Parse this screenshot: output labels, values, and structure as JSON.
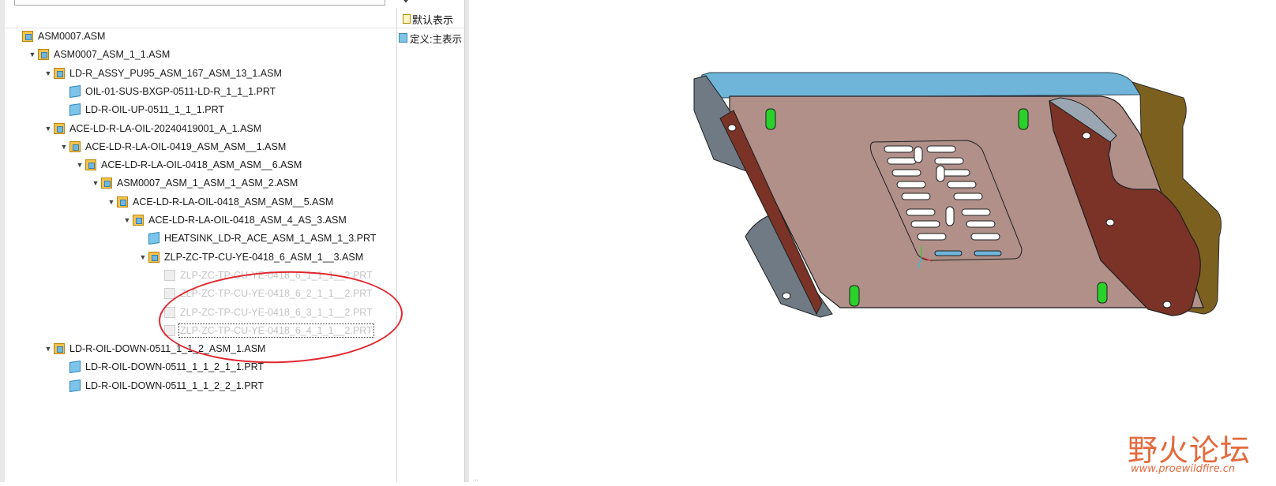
{
  "search": {
    "placeholder": ""
  },
  "columns": {
    "display_header": "默认表示",
    "definition_cell": "定义:主表示"
  },
  "tree": [
    {
      "label": "ASM0007.ASM",
      "toggle": "",
      "type": "asm"
    },
    {
      "label": "ASM0007_ASM_1_1.ASM",
      "toggle": "▼",
      "type": "asm"
    },
    {
      "label": "LD-R_ASSY_PU95_ASM_167_ASM_13_1.ASM",
      "toggle": "▼",
      "type": "asm"
    },
    {
      "label": "OIL-01-SUS-BXGP-0511-LD-R_1_1_1.PRT",
      "toggle": "",
      "type": "prt"
    },
    {
      "label": "LD-R-OIL-UP-0511_1_1_1.PRT",
      "toggle": "",
      "type": "prt"
    },
    {
      "label": "ACE-LD-R-LA-OIL-20240419001_A_1.ASM",
      "toggle": "▼",
      "type": "asm"
    },
    {
      "label": "ACE-LD-R-LA-OIL-0419_ASM_ASM__1.ASM",
      "toggle": "▼",
      "type": "asm"
    },
    {
      "label": "ACE-LD-R-LA-OIL-0418_ASM_ASM__6.ASM",
      "toggle": "▼",
      "type": "asm"
    },
    {
      "label": "ASM0007_ASM_1_ASM_1_ASM_2.ASM",
      "toggle": "▼",
      "type": "asm"
    },
    {
      "label": "ACE-LD-R-LA-OIL-0418_ASM_ASM__5.ASM",
      "toggle": "▼",
      "type": "asm"
    },
    {
      "label": "ACE-LD-R-LA-OIL-0418_ASM_4_AS_3.ASM",
      "toggle": "▼",
      "type": "asm"
    },
    {
      "label": "HEATSINK_LD-R_ACE_ASM_1_ASM_1_3.PRT",
      "toggle": "",
      "type": "prt"
    },
    {
      "label": "ZLP-ZC-TP-CU-YE-0418_6_ASM_1__3.ASM",
      "toggle": "▼",
      "type": "asm"
    },
    {
      "label": "ZLP-ZC-TP-CU-YE-0418_6_1_1_1__2.PRT",
      "toggle": "",
      "type": "prt-sup"
    },
    {
      "label": "ZLP-ZC-TP-CU-YE-0418_6_2_1_1__2.PRT",
      "toggle": "",
      "type": "prt-sup"
    },
    {
      "label": "ZLP-ZC-TP-CU-YE-0418_6_3_1_1__2.PRT",
      "toggle": "",
      "type": "prt-sup"
    },
    {
      "label": "ZLP-ZC-TP-CU-YE-0418_6_4_1_1__2.PRT",
      "toggle": "",
      "type": "prt-sup"
    },
    {
      "label": "LD-R-OIL-DOWN-0511_1_1_2_ASM_1.ASM",
      "toggle": "▼",
      "type": "asm"
    },
    {
      "label": "LD-R-OIL-DOWN-0511_1_1_2_1_1.PRT",
      "toggle": "",
      "type": "prt"
    },
    {
      "label": "LD-R-OIL-DOWN-0511_1_1_2_2_1.PRT",
      "toggle": "",
      "type": "prt"
    }
  ],
  "viewport": {
    "status_text": "..."
  },
  "watermark": {
    "brand": "野火论坛",
    "url": "www.proewildfire.cn"
  },
  "colors": {
    "plate": "#b09089",
    "edge_blue": "#6fb5d9",
    "wall": "#7a3326",
    "side": "#8a6a2a",
    "pin": "#2bd12b",
    "annotation": "#e1262e"
  }
}
